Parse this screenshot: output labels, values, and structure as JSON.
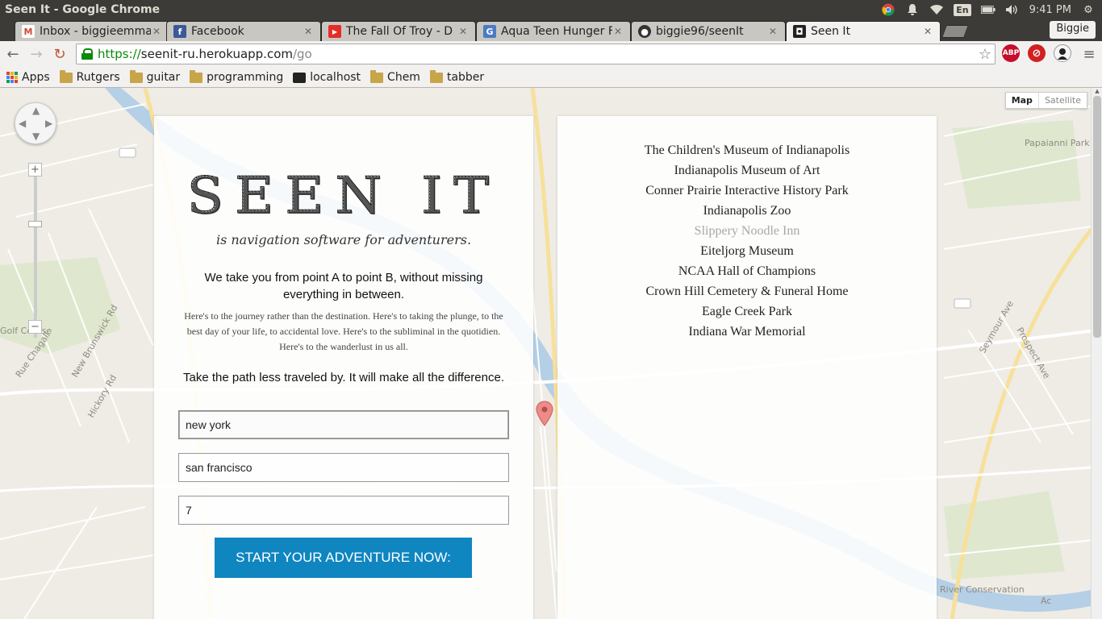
{
  "os": {
    "window_title": "Seen It - Google Chrome",
    "language": "En",
    "clock": "9:41 PM"
  },
  "browser": {
    "tabs": [
      {
        "label": "Inbox - biggieemmar",
        "icon": "gmail-icon",
        "color": "#d14836",
        "glyph": "M"
      },
      {
        "label": "Facebook",
        "icon": "facebook-icon",
        "color": "#3b5998",
        "glyph": "f"
      },
      {
        "label": "The Fall Of Troy - D",
        "icon": "youtube-icon",
        "color": "#e52d27",
        "glyph": "▶"
      },
      {
        "label": "Aqua Teen Hunger F",
        "icon": "translate-icon",
        "color": "#4a7bc4",
        "glyph": "G"
      },
      {
        "label": "biggie96/seenIt",
        "icon": "github-icon",
        "color": "#333333",
        "glyph": "●"
      },
      {
        "label": "Seen It",
        "icon": "seenit-icon",
        "color": "#222222",
        "glyph": "◘"
      }
    ],
    "profile": "Biggie",
    "url_scheme": "https://",
    "url_host": "seenit-ru.herokuapp.com",
    "url_path": "/go",
    "extensions": [
      {
        "label": "ABP",
        "color": "#c70d2c"
      },
      {
        "label": "⊘",
        "color": "#d02020"
      }
    ],
    "bookmarks": [
      {
        "label": "Apps",
        "kind": "apps"
      },
      {
        "label": "Rutgers",
        "kind": "folder"
      },
      {
        "label": "guitar",
        "kind": "folder"
      },
      {
        "label": "programming",
        "kind": "folder"
      },
      {
        "label": "localhost",
        "kind": "page"
      },
      {
        "label": "Chem",
        "kind": "folder"
      },
      {
        "label": "tabber",
        "kind": "folder"
      }
    ]
  },
  "map": {
    "type_map": "Map",
    "type_satellite": "Satellite"
  },
  "app": {
    "logo": "SEEN IT",
    "tagline": "is navigation software for adventurers.",
    "lead": "We take you from point A to point B, without missing everything in between.",
    "fine_print": "Here's to the journey rather than the destination. Here's to taking the plunge, to the best day of your life, to accidental love. Here's to the subliminal in the quotidien. Here's to the wanderlust in us all.",
    "motto": "Take the path less traveled by. It will make all the difference.",
    "origin": "new york",
    "destination": "san francisco",
    "stops": "7",
    "cta": "START YOUR ADVENTURE NOW:",
    "accent": "#0f86c0"
  },
  "places": [
    {
      "name": "The Children's Museum of Indianapolis",
      "muted": false
    },
    {
      "name": "Indianapolis Museum of Art",
      "muted": false
    },
    {
      "name": "Conner Prairie Interactive History Park",
      "muted": false
    },
    {
      "name": "Indianapolis Zoo",
      "muted": false
    },
    {
      "name": "Slippery Noodle Inn",
      "muted": true
    },
    {
      "name": "Eiteljorg Museum",
      "muted": false
    },
    {
      "name": "NCAA Hall of Champions",
      "muted": false
    },
    {
      "name": "Crown Hill Cemetery & Funeral Home",
      "muted": false
    },
    {
      "name": "Eagle Creek Park",
      "muted": false
    },
    {
      "name": "Indiana War Memorial",
      "muted": false
    }
  ]
}
